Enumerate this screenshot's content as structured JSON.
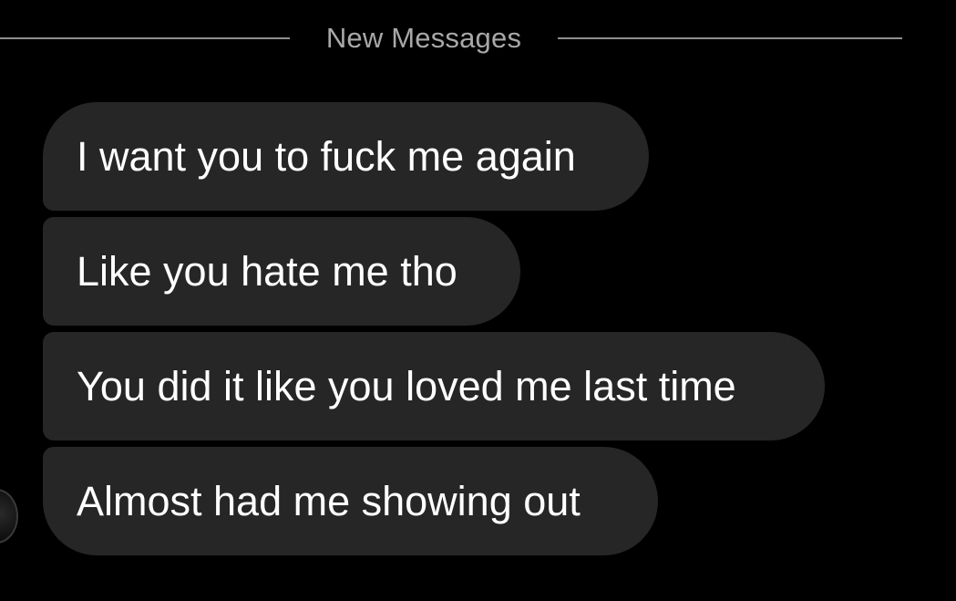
{
  "divider": {
    "label": "New Messages"
  },
  "messages": [
    {
      "text": "I want you to fuck me again"
    },
    {
      "text": "Like you hate me tho"
    },
    {
      "text": "You did it like you loved me last time"
    },
    {
      "text": "Almost had me showing out"
    }
  ],
  "colors": {
    "background": "#000000",
    "bubble": "#262626",
    "bubble_text": "#ffffff",
    "divider_text": "#a8a8a8",
    "divider_line": "#8e8e8e"
  }
}
